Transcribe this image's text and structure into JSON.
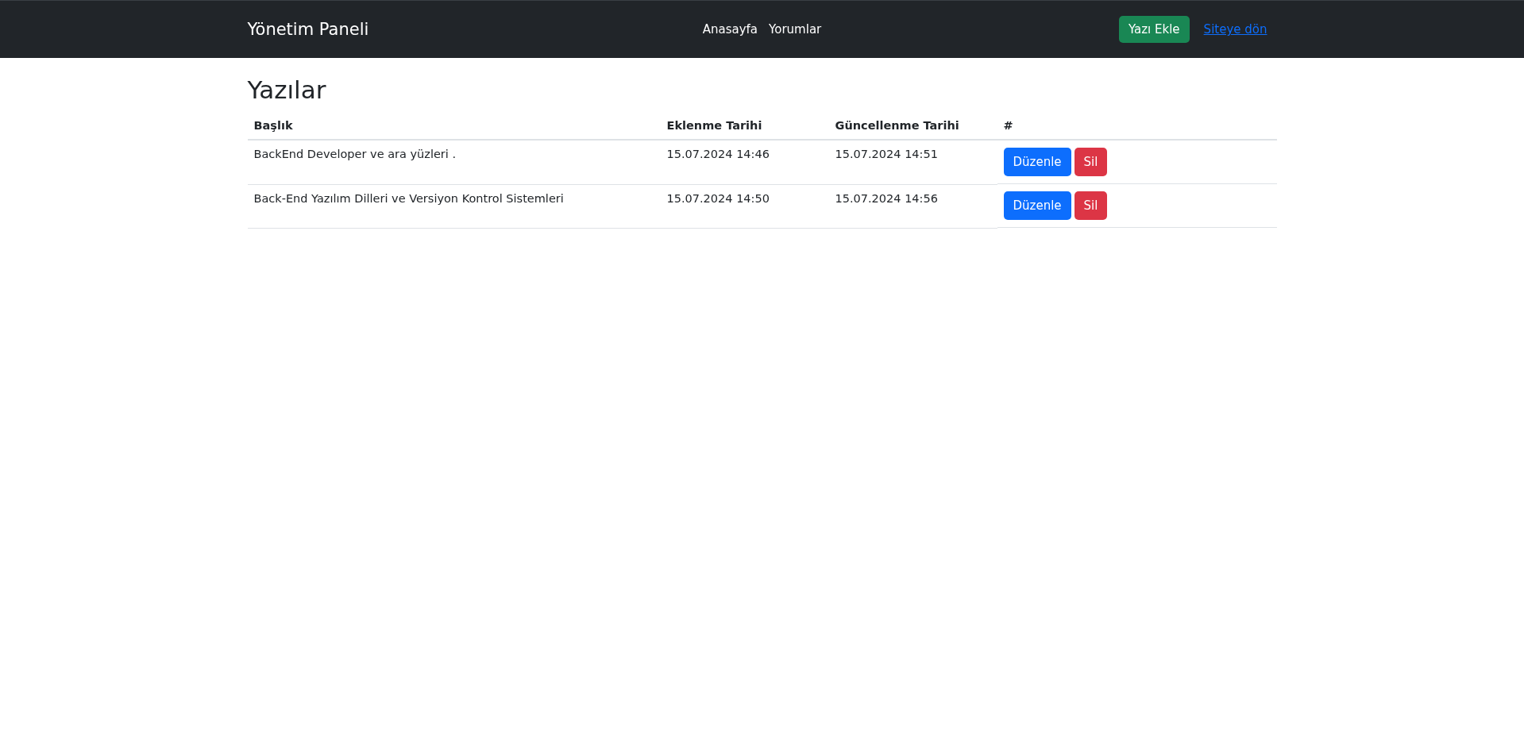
{
  "navbar": {
    "brand": "Yönetim Paneli",
    "links": [
      {
        "label": "Anasayfa"
      },
      {
        "label": "Yorumlar"
      }
    ],
    "add_button": "Yazı Ekle",
    "back_link": "Siteye dön"
  },
  "page_title": "Yazılar",
  "table": {
    "columns": [
      "Başlık",
      "Eklenme Tarihi",
      "Güncellenme Tarihi",
      "#"
    ],
    "rows": [
      {
        "title": "BackEnd Developer ve ara yüzleri .",
        "created": "15.07.2024 14:46",
        "updated": "15.07.2024 14:51",
        "edit": "Düzenle",
        "delete": "Sil"
      },
      {
        "title": "Back-End Yazılım Dilleri ve Versiyon Kontrol Sistemleri",
        "created": "15.07.2024 14:50",
        "updated": "15.07.2024 14:56",
        "edit": "Düzenle",
        "delete": "Sil"
      }
    ]
  }
}
